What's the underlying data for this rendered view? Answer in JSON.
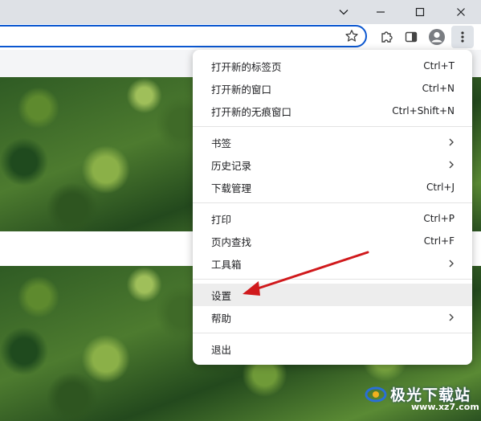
{
  "window": {
    "controls": [
      "chevron-down",
      "minimize",
      "maximize",
      "close"
    ]
  },
  "menu": {
    "group1": [
      {
        "label": "打开新的标签页",
        "shortcut": "Ctrl+T"
      },
      {
        "label": "打开新的窗口",
        "shortcut": "Ctrl+N"
      },
      {
        "label": "打开新的无痕窗口",
        "shortcut": "Ctrl+Shift+N"
      }
    ],
    "group2": [
      {
        "label": "书签",
        "submenu": true
      },
      {
        "label": "历史记录",
        "submenu": true
      },
      {
        "label": "下载管理",
        "shortcut": "Ctrl+J"
      }
    ],
    "group3": [
      {
        "label": "打印",
        "shortcut": "Ctrl+P"
      },
      {
        "label": "页内查找",
        "shortcut": "Ctrl+F"
      },
      {
        "label": "工具箱",
        "submenu": true
      }
    ],
    "group4": [
      {
        "label": "设置",
        "highlighted": true
      },
      {
        "label": "帮助",
        "submenu": true
      }
    ],
    "group5": [
      {
        "label": "退出"
      }
    ]
  },
  "annotation": {
    "type": "red-arrow",
    "color": "#d0191c"
  },
  "watermark": {
    "text": "极光下载站",
    "sub": "www.xz7.com"
  },
  "colors": {
    "omnibox_border": "#0b57d0",
    "menu_highlight": "#ededed",
    "titlebar": "#dee1e6"
  }
}
